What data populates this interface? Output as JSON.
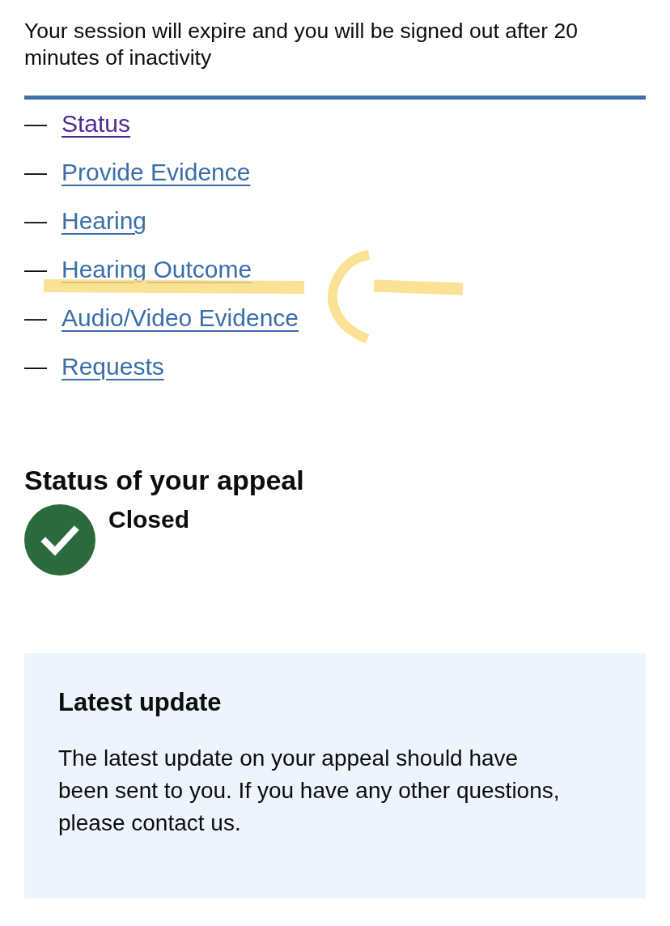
{
  "session_notice": "Your session will expire and you will be signed out after 20 minutes of inactivity",
  "nav_links": [
    {
      "prefix": "—",
      "label": "Status",
      "visited": true,
      "highlighted": false
    },
    {
      "prefix": "—",
      "label": "Provide Evidence",
      "visited": false,
      "highlighted": false
    },
    {
      "prefix": "—",
      "label": "Hearing",
      "visited": false,
      "highlighted": false
    },
    {
      "prefix": "—",
      "label": "Hearing Outcome",
      "visited": false,
      "highlighted": true
    },
    {
      "prefix": "—",
      "label": "Audio/Video Evidence",
      "visited": false,
      "highlighted": false
    },
    {
      "prefix": "—",
      "label": "Requests",
      "visited": false,
      "highlighted": false
    }
  ],
  "appeal_status": {
    "heading": "Status of your appeal",
    "state": "Closed"
  },
  "latest_update": {
    "title": "Latest update",
    "body": "The latest update on your appeal should have\nbeen sent to you. If you have any other questions,\nplease contact us."
  }
}
